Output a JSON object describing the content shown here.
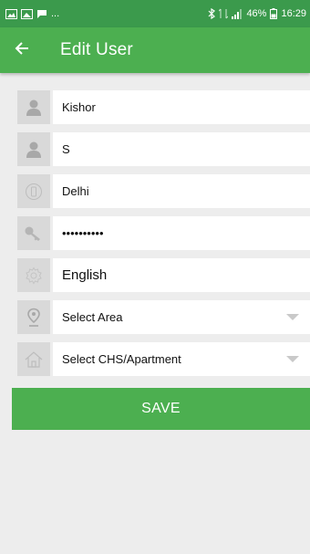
{
  "status_bar": {
    "left_ellipsis": "...",
    "battery": "46%",
    "time": "16:29",
    "left_icons": [
      "image-notification-icon",
      "gallery-icon",
      "chat-icon"
    ],
    "right_icons": [
      "bluetooth-icon",
      "network-icon",
      "signal-icon",
      "battery-icon"
    ]
  },
  "app_bar": {
    "title": "Edit User",
    "color": "#4caf50",
    "back_icon": "arrow-left-icon"
  },
  "form": {
    "first_name": {
      "icon": "person-icon",
      "value": "Kishor"
    },
    "last_name": {
      "icon": "person-icon",
      "value": "S"
    },
    "city": {
      "icon": "phone-icon",
      "value": "Delhi"
    },
    "password": {
      "icon": "key-icon",
      "value": "••••••••••"
    },
    "language": {
      "icon": "gear-icon",
      "value": "English"
    },
    "area": {
      "icon": "location-pin-icon",
      "value": "Select Area"
    },
    "apartment": {
      "icon": "home-icon",
      "value": "Select CHS/Apartment"
    }
  },
  "actions": {
    "save_label": "SAVE"
  }
}
